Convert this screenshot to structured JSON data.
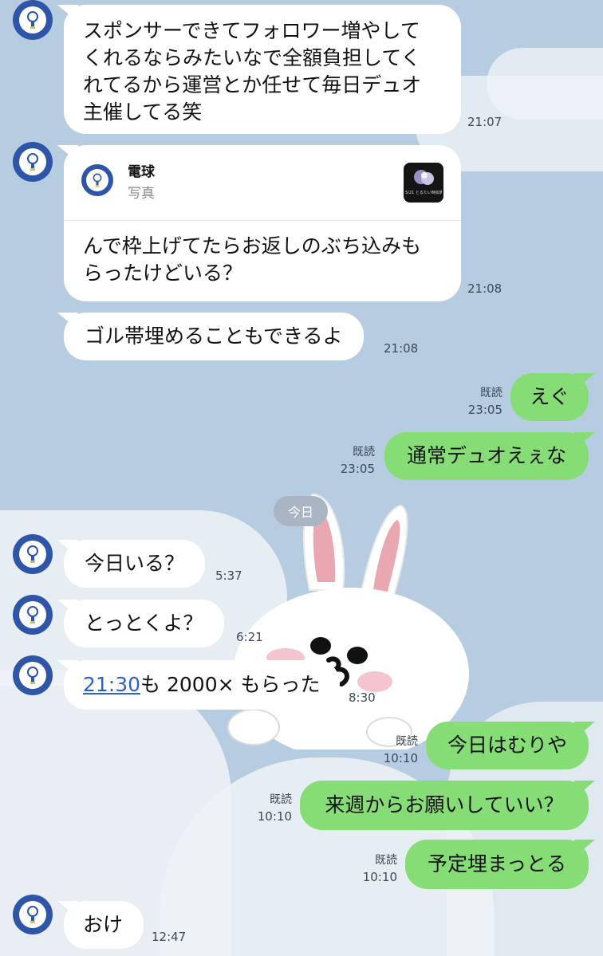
{
  "colors": {
    "background": "#b6cce0",
    "incoming_bubble": "#ffffff",
    "outgoing_bubble": "#86dd76",
    "avatar": "#2e55a7",
    "link": "#2d62c8"
  },
  "icons": {
    "avatar": "lightbulb-icon",
    "sticker": "rabbit-sticker"
  },
  "messages": [
    {
      "id": "m1",
      "from": "other",
      "text_lines": [
        "スポンサーできてフォロワー増やして",
        "くれるならみたいなで全額負担してく",
        "れてるから運営とか任せて毎日デュオ",
        "主催してる笑"
      ],
      "time": "21:07"
    },
    {
      "id": "m2",
      "from": "other",
      "reply_to": {
        "name": "電球",
        "type": "写真",
        "thumb_caption": "5/21 とるたい時間表示"
      },
      "text_lines": [
        "んで枠上げてたらお返しのぶち込みも",
        "らったけどいる？"
      ],
      "time": "21:08"
    },
    {
      "id": "m3",
      "from": "other",
      "text": "ゴル帯埋めることもできるよ",
      "time": "21:08"
    },
    {
      "id": "m4",
      "from": "me",
      "text": "えぐ",
      "read": "既読",
      "time": "23:05"
    },
    {
      "id": "m5",
      "from": "me",
      "text": "通常デュオえぇな",
      "read": "既読",
      "time": "23:05"
    },
    {
      "id": "m6",
      "from": "other",
      "text": "今日いる？",
      "time": "5:37"
    },
    {
      "id": "m7",
      "from": "other",
      "text": "とっとくよ？",
      "time": "6:21"
    },
    {
      "id": "m8",
      "from": "other",
      "link": "21:30",
      "text_after": "も 2000× もらった",
      "time": "8:30"
    },
    {
      "id": "m9",
      "from": "me",
      "text": "今日はむりや",
      "read": "既読",
      "time": "10:10"
    },
    {
      "id": "m10",
      "from": "me",
      "text": "来週からお願いしていい？",
      "read": "既読",
      "time": "10:10"
    },
    {
      "id": "m11",
      "from": "me",
      "text": "予定埋まっとる",
      "read": "既読",
      "time": "10:10"
    },
    {
      "id": "m12",
      "from": "other",
      "text": "おけ",
      "time": "12:47"
    }
  ],
  "date_divider": "今日"
}
